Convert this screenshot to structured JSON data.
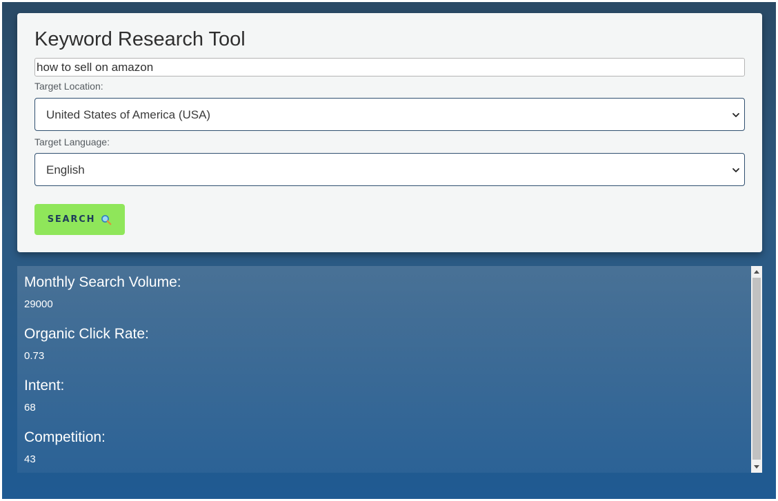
{
  "app": {
    "title": "Keyword Research Tool"
  },
  "form": {
    "keyword_value": "how to sell on amazon",
    "location_label": "Target Location:",
    "location_value": "United States of America (USA)",
    "language_label": "Target Language:",
    "language_value": "English",
    "search_label": "SEARCH",
    "search_icon": "magnifying-glass-icon"
  },
  "results": {
    "items": [
      {
        "label": "Monthly Search Volume:",
        "value": "29000"
      },
      {
        "label": "Organic Click Rate:",
        "value": "0.73"
      },
      {
        "label": "Intent:",
        "value": "68"
      },
      {
        "label": "Competition:",
        "value": "43"
      }
    ]
  },
  "colors": {
    "accent_button": "#8fe65a",
    "button_text": "#1e3c5a",
    "background_top": "#2a4a66",
    "background_bottom": "#1f5a92",
    "card": "#f4f6f6"
  }
}
